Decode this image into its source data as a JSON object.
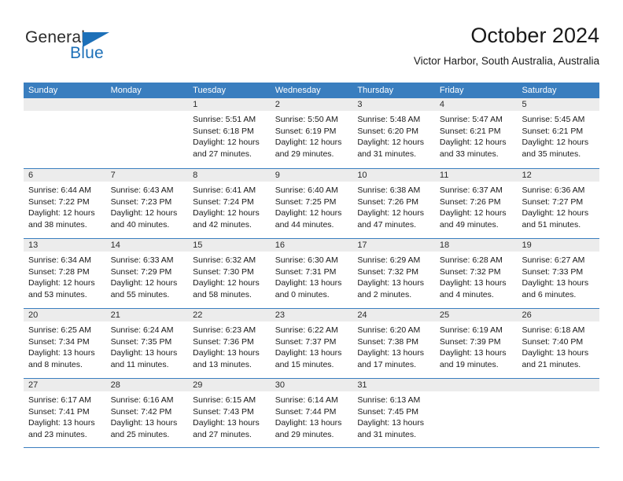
{
  "brand": {
    "name_part1": "General",
    "name_part2": "Blue",
    "accent_color": "#1d70b8"
  },
  "header": {
    "title": "October 2024",
    "subtitle": "Victor Harbor, South Australia, Australia"
  },
  "colors": {
    "header_row": "#3a7ebf",
    "daynum_band": "#ececec",
    "text": "#1a1a1a"
  },
  "weekdays": [
    "Sunday",
    "Monday",
    "Tuesday",
    "Wednesday",
    "Thursday",
    "Friday",
    "Saturday"
  ],
  "weeks": [
    [
      {
        "day": "",
        "lines": []
      },
      {
        "day": "",
        "lines": []
      },
      {
        "day": "1",
        "lines": [
          "Sunrise: 5:51 AM",
          "Sunset: 6:18 PM",
          "Daylight: 12 hours",
          "and 27 minutes."
        ]
      },
      {
        "day": "2",
        "lines": [
          "Sunrise: 5:50 AM",
          "Sunset: 6:19 PM",
          "Daylight: 12 hours",
          "and 29 minutes."
        ]
      },
      {
        "day": "3",
        "lines": [
          "Sunrise: 5:48 AM",
          "Sunset: 6:20 PM",
          "Daylight: 12 hours",
          "and 31 minutes."
        ]
      },
      {
        "day": "4",
        "lines": [
          "Sunrise: 5:47 AM",
          "Sunset: 6:21 PM",
          "Daylight: 12 hours",
          "and 33 minutes."
        ]
      },
      {
        "day": "5",
        "lines": [
          "Sunrise: 5:45 AM",
          "Sunset: 6:21 PM",
          "Daylight: 12 hours",
          "and 35 minutes."
        ]
      }
    ],
    [
      {
        "day": "6",
        "lines": [
          "Sunrise: 6:44 AM",
          "Sunset: 7:22 PM",
          "Daylight: 12 hours",
          "and 38 minutes."
        ]
      },
      {
        "day": "7",
        "lines": [
          "Sunrise: 6:43 AM",
          "Sunset: 7:23 PM",
          "Daylight: 12 hours",
          "and 40 minutes."
        ]
      },
      {
        "day": "8",
        "lines": [
          "Sunrise: 6:41 AM",
          "Sunset: 7:24 PM",
          "Daylight: 12 hours",
          "and 42 minutes."
        ]
      },
      {
        "day": "9",
        "lines": [
          "Sunrise: 6:40 AM",
          "Sunset: 7:25 PM",
          "Daylight: 12 hours",
          "and 44 minutes."
        ]
      },
      {
        "day": "10",
        "lines": [
          "Sunrise: 6:38 AM",
          "Sunset: 7:26 PM",
          "Daylight: 12 hours",
          "and 47 minutes."
        ]
      },
      {
        "day": "11",
        "lines": [
          "Sunrise: 6:37 AM",
          "Sunset: 7:26 PM",
          "Daylight: 12 hours",
          "and 49 minutes."
        ]
      },
      {
        "day": "12",
        "lines": [
          "Sunrise: 6:36 AM",
          "Sunset: 7:27 PM",
          "Daylight: 12 hours",
          "and 51 minutes."
        ]
      }
    ],
    [
      {
        "day": "13",
        "lines": [
          "Sunrise: 6:34 AM",
          "Sunset: 7:28 PM",
          "Daylight: 12 hours",
          "and 53 minutes."
        ]
      },
      {
        "day": "14",
        "lines": [
          "Sunrise: 6:33 AM",
          "Sunset: 7:29 PM",
          "Daylight: 12 hours",
          "and 55 minutes."
        ]
      },
      {
        "day": "15",
        "lines": [
          "Sunrise: 6:32 AM",
          "Sunset: 7:30 PM",
          "Daylight: 12 hours",
          "and 58 minutes."
        ]
      },
      {
        "day": "16",
        "lines": [
          "Sunrise: 6:30 AM",
          "Sunset: 7:31 PM",
          "Daylight: 13 hours",
          "and 0 minutes."
        ]
      },
      {
        "day": "17",
        "lines": [
          "Sunrise: 6:29 AM",
          "Sunset: 7:32 PM",
          "Daylight: 13 hours",
          "and 2 minutes."
        ]
      },
      {
        "day": "18",
        "lines": [
          "Sunrise: 6:28 AM",
          "Sunset: 7:32 PM",
          "Daylight: 13 hours",
          "and 4 minutes."
        ]
      },
      {
        "day": "19",
        "lines": [
          "Sunrise: 6:27 AM",
          "Sunset: 7:33 PM",
          "Daylight: 13 hours",
          "and 6 minutes."
        ]
      }
    ],
    [
      {
        "day": "20",
        "lines": [
          "Sunrise: 6:25 AM",
          "Sunset: 7:34 PM",
          "Daylight: 13 hours",
          "and 8 minutes."
        ]
      },
      {
        "day": "21",
        "lines": [
          "Sunrise: 6:24 AM",
          "Sunset: 7:35 PM",
          "Daylight: 13 hours",
          "and 11 minutes."
        ]
      },
      {
        "day": "22",
        "lines": [
          "Sunrise: 6:23 AM",
          "Sunset: 7:36 PM",
          "Daylight: 13 hours",
          "and 13 minutes."
        ]
      },
      {
        "day": "23",
        "lines": [
          "Sunrise: 6:22 AM",
          "Sunset: 7:37 PM",
          "Daylight: 13 hours",
          "and 15 minutes."
        ]
      },
      {
        "day": "24",
        "lines": [
          "Sunrise: 6:20 AM",
          "Sunset: 7:38 PM",
          "Daylight: 13 hours",
          "and 17 minutes."
        ]
      },
      {
        "day": "25",
        "lines": [
          "Sunrise: 6:19 AM",
          "Sunset: 7:39 PM",
          "Daylight: 13 hours",
          "and 19 minutes."
        ]
      },
      {
        "day": "26",
        "lines": [
          "Sunrise: 6:18 AM",
          "Sunset: 7:40 PM",
          "Daylight: 13 hours",
          "and 21 minutes."
        ]
      }
    ],
    [
      {
        "day": "27",
        "lines": [
          "Sunrise: 6:17 AM",
          "Sunset: 7:41 PM",
          "Daylight: 13 hours",
          "and 23 minutes."
        ]
      },
      {
        "day": "28",
        "lines": [
          "Sunrise: 6:16 AM",
          "Sunset: 7:42 PM",
          "Daylight: 13 hours",
          "and 25 minutes."
        ]
      },
      {
        "day": "29",
        "lines": [
          "Sunrise: 6:15 AM",
          "Sunset: 7:43 PM",
          "Daylight: 13 hours",
          "and 27 minutes."
        ]
      },
      {
        "day": "30",
        "lines": [
          "Sunrise: 6:14 AM",
          "Sunset: 7:44 PM",
          "Daylight: 13 hours",
          "and 29 minutes."
        ]
      },
      {
        "day": "31",
        "lines": [
          "Sunrise: 6:13 AM",
          "Sunset: 7:45 PM",
          "Daylight: 13 hours",
          "and 31 minutes."
        ]
      },
      {
        "day": "",
        "lines": []
      },
      {
        "day": "",
        "lines": []
      }
    ]
  ]
}
